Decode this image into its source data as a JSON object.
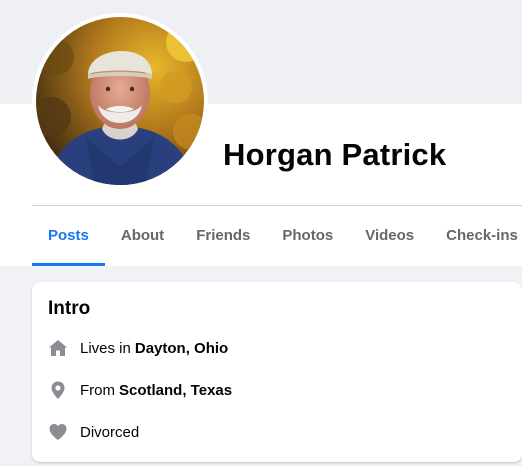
{
  "profile": {
    "name": "Horgan Patrick"
  },
  "tabs": [
    {
      "label": "Posts",
      "active": true
    },
    {
      "label": "About",
      "active": false
    },
    {
      "label": "Friends",
      "active": false
    },
    {
      "label": "Photos",
      "active": false
    },
    {
      "label": "Videos",
      "active": false
    },
    {
      "label": "Check-ins",
      "active": false
    }
  ],
  "intro": {
    "title": "Intro",
    "items": [
      {
        "icon": "home-icon",
        "prefix": "Lives in",
        "value": "Dayton, Ohio"
      },
      {
        "icon": "location-pin-icon",
        "prefix": "From",
        "value": "Scotland, Texas"
      },
      {
        "icon": "heart-icon",
        "prefix": "Divorced",
        "value": ""
      }
    ]
  },
  "colors": {
    "accent": "#1877f2",
    "page_bg": "#f0f2f5",
    "muted_text": "#65676b",
    "icon_gray": "#8a8d91"
  }
}
